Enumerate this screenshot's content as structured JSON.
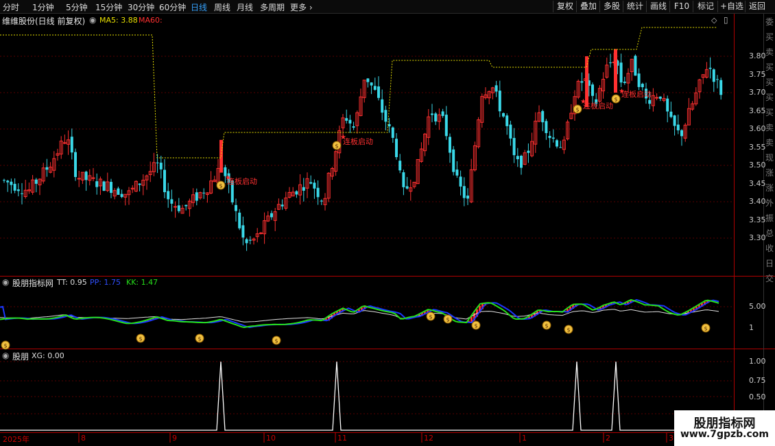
{
  "toolbar": {
    "periods": [
      "分时",
      "1分钟",
      "5分钟",
      "15分钟",
      "30分钟",
      "60分钟",
      "日线",
      "周线",
      "月线",
      "多周期",
      "更多"
    ],
    "active_period": "日线",
    "buttons": [
      "复权",
      "叠加",
      "多股",
      "统计",
      "画线",
      "F10",
      "标记",
      "+自选",
      "返回"
    ]
  },
  "main_panel": {
    "title": "维维股份(日线 前复权)",
    "ma5_label": "MA5: 3.88",
    "ma60_label": "MA60:",
    "annotations": [
      "连板启动",
      "连板启动",
      "连板启动",
      "连板启动"
    ],
    "y_ticks": [
      "3.80",
      "3.75",
      "3.70",
      "3.65",
      "3.60",
      "3.55",
      "3.50",
      "3.45",
      "3.40",
      "3.35",
      "3.30"
    ]
  },
  "indicator_panel": {
    "title": "股朋指标网",
    "tt_label": "TT: 0.95",
    "pp_label": "PP: 1.75",
    "kk_label": "KK: 1.47",
    "y_ticks": [
      "5.00",
      "1"
    ]
  },
  "xg_panel": {
    "title": "股朋",
    "xg_label": "XG: 0.00",
    "y_ticks": [
      "1.00",
      "0.75",
      "0.50"
    ]
  },
  "x_axis": {
    "labels": [
      "2025年",
      "8",
      "9",
      "10",
      "11",
      "12",
      "1",
      "2",
      "3"
    ]
  },
  "right_column_chars": [
    "委",
    "买",
    "卖",
    "买",
    "买",
    "买",
    "买",
    "卖",
    "卖",
    "现",
    "涨",
    "涨",
    "外",
    "振",
    "总",
    "收",
    "日",
    "交"
  ],
  "watermark": {
    "line1": "股朋指标网",
    "line2": "www.7gpzb.com"
  },
  "colors": {
    "up": "#ff3030",
    "down": "#3ad8e8",
    "ma60": "#e8e000",
    "tt": "#e0e0e0",
    "pp": "#1a38ff",
    "kk": "#26e01a",
    "active_tab": "#36a3ff"
  },
  "icons": [
    "money-bag-icon",
    "dropdown-circle-icon",
    "diamond-icon",
    "window-icon",
    "chevron-right-icon"
  ]
}
